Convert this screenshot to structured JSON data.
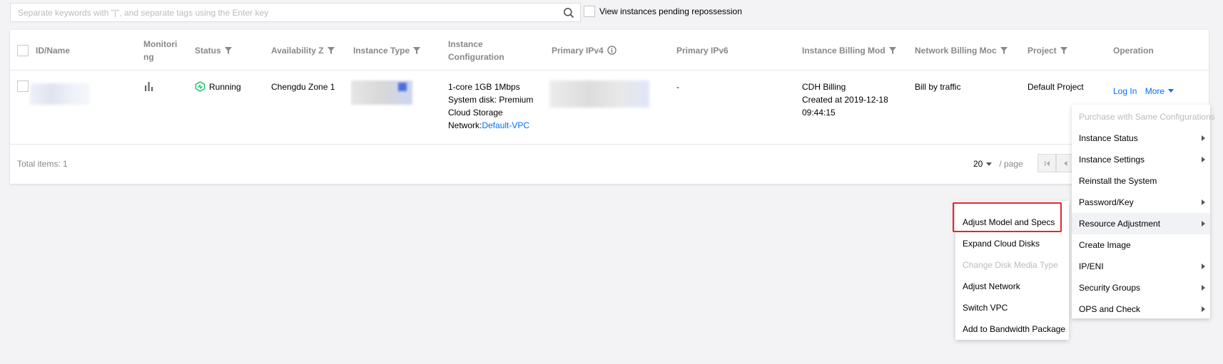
{
  "search": {
    "placeholder": "Separate keywords with \"|\", and separate tags using the Enter key",
    "value": ""
  },
  "pending_filter": {
    "label": "View instances pending repossession",
    "checked": false
  },
  "table": {
    "columns": {
      "id_name": "ID/Name",
      "monitoring_line1": "Monitori",
      "monitoring_line2": "ng",
      "status": "Status",
      "availability_zone": "Availability Z",
      "instance_type": "Instance Type",
      "instance_config_line1": "Instance",
      "instance_config_line2": "Configuration",
      "primary_ipv4": "Primary IPv4",
      "primary_ipv6": "Primary IPv6",
      "instance_billing": "Instance Billing Mod",
      "network_billing": "Network Billing Moc",
      "project": "Project",
      "operation": "Operation"
    },
    "rows": [
      {
        "status": "Running",
        "availability_zone": "Chengdu Zone 1",
        "config_line1": "1-core 1GB 1Mbps",
        "config_line2": "System disk: Premium",
        "config_line3": "Cloud Storage",
        "config_network_label": "Network:",
        "config_network_link": "Default-VPC",
        "primary_ipv6": "-",
        "billing_line1": "CDH Billing",
        "billing_line2": "Created at 2019-12-18",
        "billing_line3": "09:44:15",
        "network_billing": "Bill by traffic",
        "project": "Default Project",
        "op_login": "Log In",
        "op_more": "More"
      }
    ]
  },
  "footer": {
    "total_label": "Total items:  1",
    "page_size": "20",
    "per_page_label": "/ page"
  },
  "main_menu": [
    {
      "label": "Purchase with Same Configurations",
      "disabled": true,
      "submenu": false
    },
    {
      "label": "Instance Status",
      "disabled": false,
      "submenu": true
    },
    {
      "label": "Instance Settings",
      "disabled": false,
      "submenu": true
    },
    {
      "label": "Reinstall the System",
      "disabled": false,
      "submenu": false
    },
    {
      "label": "Password/Key",
      "disabled": false,
      "submenu": true
    },
    {
      "label": "Resource Adjustment",
      "disabled": false,
      "submenu": true,
      "active": true
    },
    {
      "label": "Create Image",
      "disabled": false,
      "submenu": false
    },
    {
      "label": "IP/ENI",
      "disabled": false,
      "submenu": true
    },
    {
      "label": "Security Groups",
      "disabled": false,
      "submenu": true
    },
    {
      "label": "OPS and Check",
      "disabled": false,
      "submenu": true
    }
  ],
  "sub_menu": [
    {
      "label": "Adjust Model and Specs",
      "disabled": false,
      "highlighted": true
    },
    {
      "label": "Expand Cloud Disks",
      "disabled": false
    },
    {
      "label": "Change Disk Media Type",
      "disabled": true
    },
    {
      "label": "Adjust Network",
      "disabled": false
    },
    {
      "label": "Switch VPC",
      "disabled": false
    },
    {
      "label": "Add to Bandwidth Package",
      "disabled": false
    }
  ],
  "colors": {
    "link": "#006eff",
    "running": "#0abf5b",
    "highlight": "#e1262d",
    "disabled": "#bbbbbb"
  }
}
